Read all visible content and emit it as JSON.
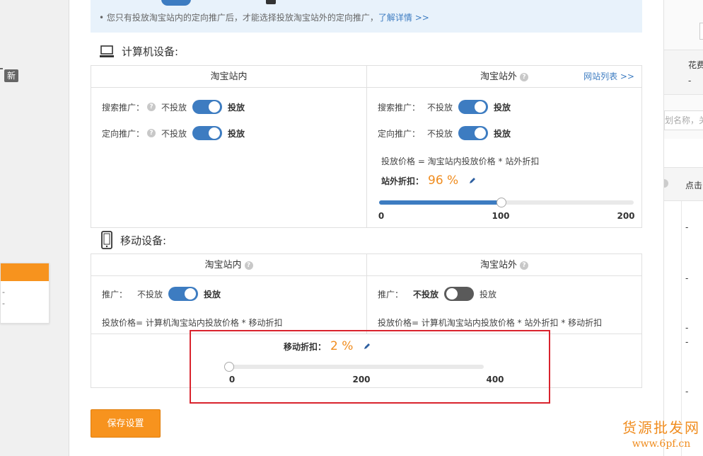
{
  "left": {
    "new_badge": "新",
    "dashes": [
      "-",
      "-"
    ]
  },
  "right": {
    "header": "花费",
    "header_dash": "-",
    "search_placeholder": "划名称，关",
    "col": "点击",
    "row_dashes": [
      "-",
      "-",
      "-",
      "-",
      "-"
    ]
  },
  "notice": {
    "text": "您只有投放淘宝站内的定向推广后，才能选择投放淘宝站外的定向推广，",
    "link": "了解详情 >>"
  },
  "computer": {
    "title": "计算机设备:",
    "inner": {
      "header": "淘宝站内",
      "rows": [
        {
          "label": "搜索推广：",
          "off": "不投放",
          "on": "投放"
        },
        {
          "label": "定向推广：",
          "off": "不投放",
          "on": "投放"
        }
      ]
    },
    "outer": {
      "header": "淘宝站外",
      "link": "网站列表 >>",
      "rows": [
        {
          "label": "搜索推广：",
          "off": "不投放",
          "on": "投放"
        },
        {
          "label": "定向推广：",
          "off": "不投放",
          "on": "投放"
        }
      ],
      "formula": "投放价格 = 淘宝站内投放价格 * 站外折扣",
      "discount_label": "站外折扣：",
      "discount_value": "96 %",
      "slider": {
        "min": 0,
        "max": 200,
        "value": 96,
        "ticks": [
          "0",
          "100",
          "200"
        ]
      }
    }
  },
  "mobile": {
    "title": "移动设备:",
    "inner": {
      "header": "淘宝站内",
      "row": {
        "label": "推广：",
        "off": "不投放",
        "on": "投放"
      },
      "formula": "投放价格= 计算机淘宝站内投放价格 * 移动折扣"
    },
    "outer": {
      "header": "淘宝站外",
      "row": {
        "label": "推广：",
        "off": "不投放",
        "on": "投放"
      },
      "formula": "投放价格= 计算机淘宝站内投放价格 * 站外折扣 * 移动折扣"
    },
    "discount_label": "移动折扣：",
    "discount_value": "2 %",
    "slider": {
      "min": 0,
      "max": 400,
      "value": 2,
      "ticks": [
        "0",
        "200",
        "400"
      ]
    }
  },
  "save_button": "保存设置",
  "watermark": {
    "line1": "货源批发网",
    "line2": "www.6pf.cn"
  },
  "colors": {
    "accent": "#3d7cc1",
    "orange": "#f7931e",
    "highlight": "#d9232d"
  }
}
